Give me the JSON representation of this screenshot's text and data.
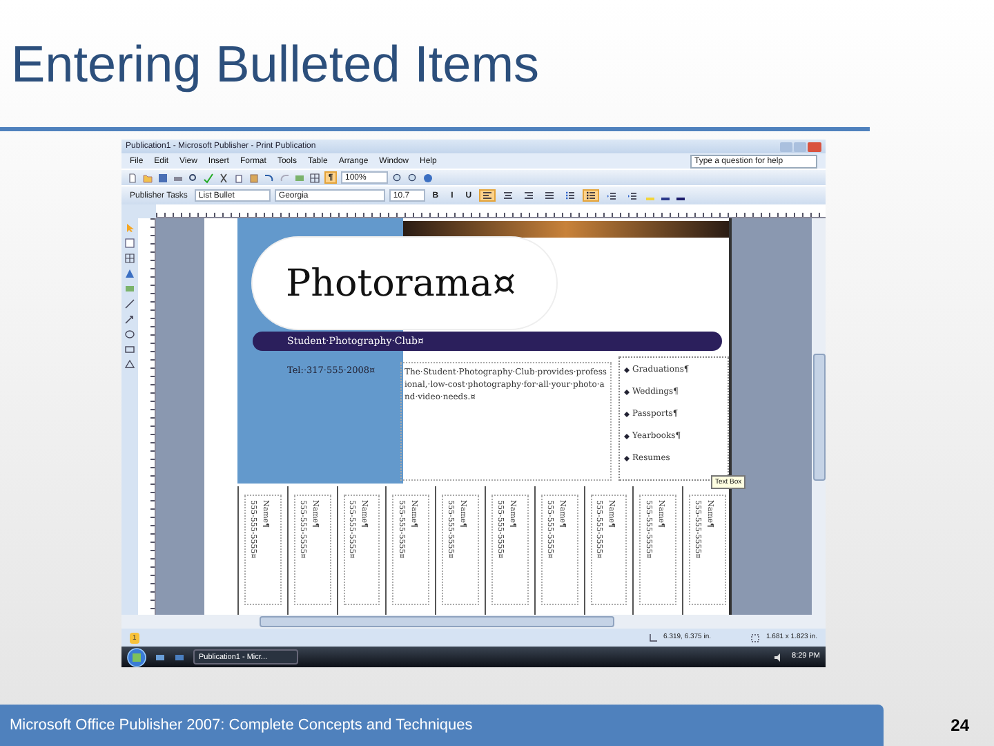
{
  "slide": {
    "title": "Entering Bulleted Items",
    "footer": "Microsoft Office Publisher 2007: Complete Concepts and Techniques",
    "page_number": "24"
  },
  "window": {
    "title": "Publication1 - Microsoft Publisher - Print Publication",
    "help_placeholder": "Type a question for help"
  },
  "menu": [
    "File",
    "Edit",
    "View",
    "Insert",
    "Format",
    "Tools",
    "Table",
    "Arrange",
    "Window",
    "Help"
  ],
  "standard_toolbar": {
    "marks": {
      "label": "¶",
      "selected": true
    },
    "zoom": "100%"
  },
  "format_toolbar": {
    "task_pane": "Publisher Tasks",
    "style": "List Bullet",
    "font": "Georgia",
    "size": "10.7",
    "buttons": [
      {
        "kind": "text",
        "label": "B",
        "selected": false
      },
      {
        "kind": "text",
        "label": "I",
        "selected": false
      },
      {
        "kind": "text",
        "label": "U",
        "selected": false
      },
      {
        "kind": "align-left",
        "selected": true
      },
      {
        "kind": "align-center",
        "selected": false
      },
      {
        "kind": "align-right",
        "selected": false
      },
      {
        "kind": "justify",
        "selected": false
      },
      {
        "kind": "numbering",
        "selected": false
      },
      {
        "kind": "bullets",
        "selected": true
      },
      {
        "kind": "indent",
        "selected": false
      },
      {
        "kind": "indent",
        "selected": false
      }
    ]
  },
  "publication": {
    "logo": "Photorama¤",
    "club": "Student·Photography·Club¤",
    "phone": "Tel:·317·555·2008¤",
    "description": "The·Student·Photography·Club·provides·professional,·low-cost·photography·for·all·your·photo·and·video·needs.¤",
    "bullets": [
      "Graduations¶",
      "Weddings¶",
      "Passports¶",
      "Yearbooks¶",
      "Resumes"
    ],
    "tooltip": "Text Box",
    "tabs": [
      {
        "name": "Name¶",
        "phone": "555-555-5555¤"
      },
      {
        "name": "Name¶",
        "phone": "555-555-5555¤"
      },
      {
        "name": "Name¶",
        "phone": "555-555-5555¤"
      },
      {
        "name": "Name¶",
        "phone": "555-555-5555¤"
      },
      {
        "name": "Name¶",
        "phone": "555-555-5555¤"
      },
      {
        "name": "Name¶",
        "phone": "555-555-5555¤"
      },
      {
        "name": "Name¶",
        "phone": "555-555-5555¤"
      },
      {
        "name": "Name¶",
        "phone": "555-555-5555¤"
      },
      {
        "name": "Name¶",
        "phone": "555-555-5555¤"
      },
      {
        "name": "Name¶",
        "phone": "555-555-5555¤"
      }
    ]
  },
  "status_bar": {
    "page": "1",
    "position": "6.319, 6.375 in.",
    "size": "1.681 x 1.823 in."
  },
  "taskbar": {
    "task": "Publication1 - Micr...",
    "time": "8:29 PM"
  }
}
